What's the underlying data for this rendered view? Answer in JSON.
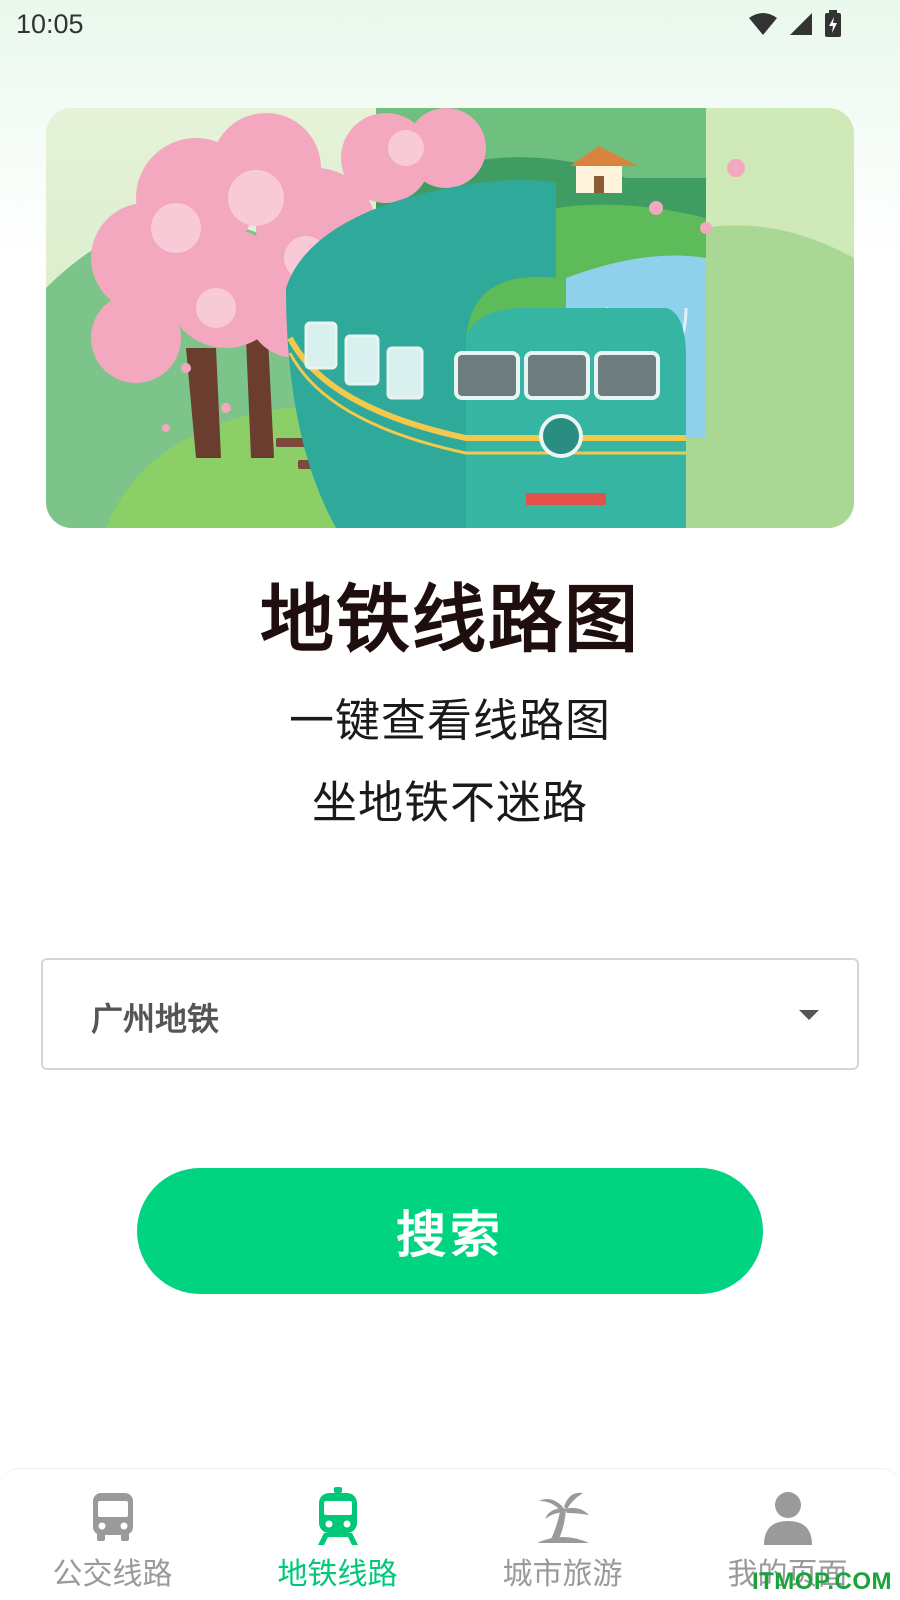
{
  "status_bar": {
    "time": "10:05"
  },
  "hero": {
    "image": "subway-train-with-cherry-blossoms-illustration"
  },
  "title": "地铁线路图",
  "subtitle_lines": [
    "一键查看线路图",
    "坐地铁不迷路"
  ],
  "city_select": {
    "value": "广州地铁"
  },
  "search_button": {
    "label": "搜索"
  },
  "bottom_nav": {
    "items": [
      {
        "label": "公交线路",
        "icon": "bus-icon",
        "active": false
      },
      {
        "label": "地铁线路",
        "icon": "subway-icon",
        "active": true
      },
      {
        "label": "城市旅游",
        "icon": "palm-tree-icon",
        "active": false
      },
      {
        "label": "我的页面",
        "icon": "person-icon",
        "active": false
      }
    ]
  },
  "colors": {
    "accent": "#00d481",
    "active_tab": "#00c878",
    "inactive_tab": "#9a9a9a",
    "title": "#1f0e0e"
  },
  "watermark": "ITMOP.COM"
}
